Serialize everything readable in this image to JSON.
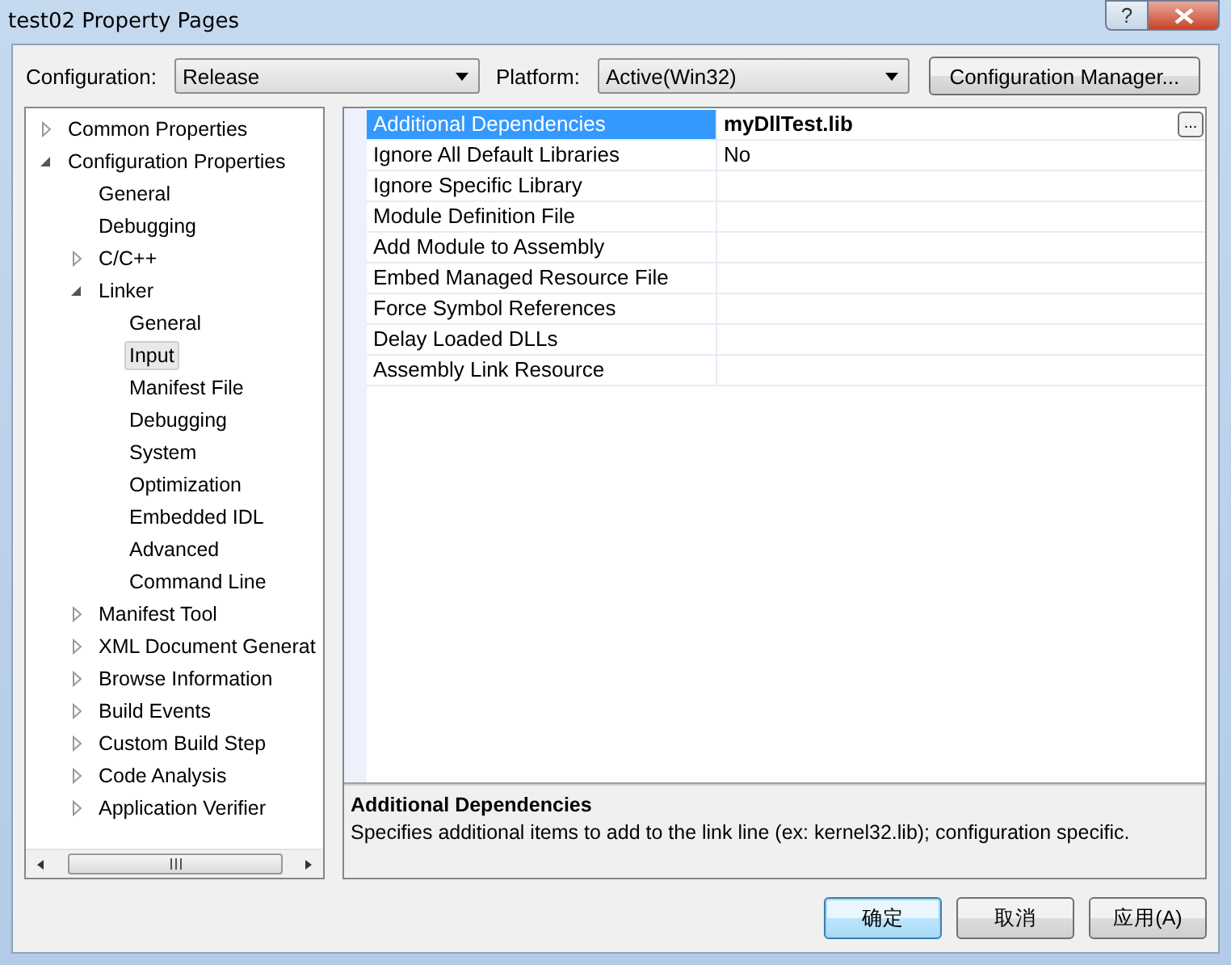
{
  "window": {
    "title": "test02 Property Pages",
    "help_button": "?"
  },
  "configuration": {
    "label": "Configuration:",
    "value": "Release"
  },
  "platform": {
    "label": "Platform:",
    "value": "Active(Win32)"
  },
  "configuration_manager_button": "Configuration Manager...",
  "tree": [
    {
      "label": "Common Properties",
      "expanded": false,
      "selected": false
    },
    {
      "label": "Configuration Properties",
      "expanded": true,
      "selected": false,
      "children": [
        {
          "label": "General",
          "selected": false
        },
        {
          "label": "Debugging",
          "selected": false
        },
        {
          "label": "C/C++",
          "expanded": false,
          "selected": false
        },
        {
          "label": "Linker",
          "expanded": true,
          "selected": false,
          "children": [
            {
              "label": "General",
              "selected": false
            },
            {
              "label": "Input",
              "selected": true
            },
            {
              "label": "Manifest File",
              "selected": false
            },
            {
              "label": "Debugging",
              "selected": false
            },
            {
              "label": "System",
              "selected": false
            },
            {
              "label": "Optimization",
              "selected": false
            },
            {
              "label": "Embedded IDL",
              "selected": false
            },
            {
              "label": "Advanced",
              "selected": false
            },
            {
              "label": "Command Line",
              "selected": false
            }
          ]
        },
        {
          "label": "Manifest Tool",
          "expanded": false,
          "selected": false
        },
        {
          "label": "XML Document Generat",
          "expanded": false,
          "selected": false
        },
        {
          "label": "Browse Information",
          "expanded": false,
          "selected": false
        },
        {
          "label": "Build Events",
          "expanded": false,
          "selected": false
        },
        {
          "label": "Custom Build Step",
          "expanded": false,
          "selected": false
        },
        {
          "label": "Code Analysis",
          "expanded": false,
          "selected": false
        },
        {
          "label": "Application Verifier",
          "expanded": false,
          "selected": false
        }
      ]
    }
  ],
  "properties": [
    {
      "name": "Additional Dependencies",
      "value": "myDllTest.lib",
      "modified": true,
      "selected": true,
      "browse_button": "..."
    },
    {
      "name": "Ignore All Default Libraries",
      "value": "No",
      "modified": false,
      "selected": false
    },
    {
      "name": "Ignore Specific Library",
      "selected": false
    },
    {
      "name": "Module Definition File",
      "selected": false
    },
    {
      "name": "Add Module to Assembly",
      "selected": false
    },
    {
      "name": "Embed Managed Resource File",
      "selected": false
    },
    {
      "name": "Force Symbol References",
      "selected": false
    },
    {
      "name": "Delay Loaded DLLs",
      "selected": false
    },
    {
      "name": "Assembly Link Resource",
      "selected": false
    }
  ],
  "description": {
    "title": "Additional Dependencies",
    "text": "Specifies additional items to add to the link line (ex: kernel32.lib); configuration specific."
  },
  "buttons": [
    {
      "label": "确定",
      "default": true
    },
    {
      "label": "取消",
      "default": false
    },
    {
      "label": "应用(A)",
      "default": false
    }
  ]
}
